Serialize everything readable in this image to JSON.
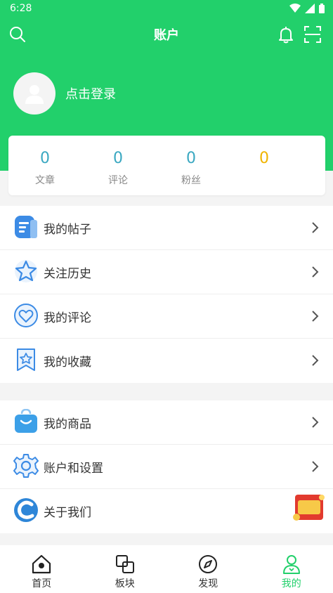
{
  "status": {
    "time": "6:28"
  },
  "header": {
    "title": "账户"
  },
  "profile": {
    "login_text": "点击登录"
  },
  "stats": [
    {
      "value": "0",
      "label": "文章"
    },
    {
      "value": "0",
      "label": "评论"
    },
    {
      "value": "0",
      "label": "粉丝"
    },
    {
      "value": "0",
      "label": ""
    }
  ],
  "menu1": [
    {
      "label": "我的帖子",
      "icon": "posts-icon"
    },
    {
      "label": "关注历史",
      "icon": "star-icon"
    },
    {
      "label": "我的评论",
      "icon": "heart-comment-icon"
    },
    {
      "label": "我的收藏",
      "icon": "bookmark-icon"
    }
  ],
  "menu2": [
    {
      "label": "我的商品",
      "icon": "shopping-bag-icon"
    },
    {
      "label": "账户和设置",
      "icon": "settings-gear-icon"
    },
    {
      "label": "关于我们",
      "icon": "about-logo-icon"
    }
  ],
  "tabs": [
    {
      "label": "首页",
      "icon": "home-icon"
    },
    {
      "label": "板块",
      "icon": "boards-icon"
    },
    {
      "label": "发现",
      "icon": "compass-icon"
    },
    {
      "label": "我的",
      "icon": "user-icon"
    }
  ],
  "colors": {
    "primary": "#22d06b",
    "stat_blue": "#3aa8c1",
    "stat_yellow": "#f0b400",
    "icon_blue": "#3c8be5"
  }
}
